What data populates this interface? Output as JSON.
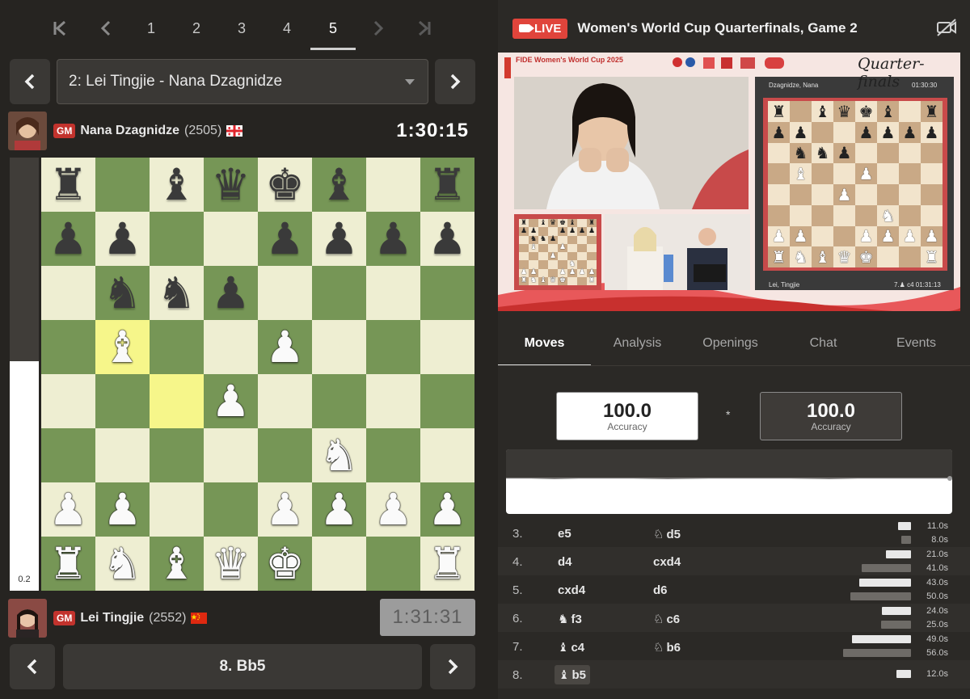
{
  "round_nav": {
    "first_icon": "first-page-icon",
    "prev_icon": "chevron-left-icon",
    "rounds": [
      "1",
      "2",
      "3",
      "4",
      "5"
    ],
    "active_round": "5",
    "next_icon": "chevron-right-icon",
    "last_icon": "last-page-icon"
  },
  "game_select": {
    "value": "2: Lei Tingjie - Nana Dzagnidze"
  },
  "top_player": {
    "title": "GM",
    "name": "Nana Dzagnidze",
    "rating": "(2505)",
    "country": "Georgia",
    "clock": "1:30:15"
  },
  "bottom_player": {
    "title": "GM",
    "name": "Lei Tingjie",
    "rating": "(2552)",
    "country": "China",
    "clock": "1:31:31"
  },
  "eval": {
    "label": "0.2",
    "white_fraction": 0.53
  },
  "board": {
    "light_color": "#eeeed2",
    "dark_color": "#769656",
    "highlight": [
      "b5",
      "c4"
    ],
    "ranks": [
      [
        "r",
        "",
        "b",
        "q",
        "k",
        "b",
        "",
        "r"
      ],
      [
        "p",
        "p",
        "",
        "",
        "p",
        "p",
        "p",
        "p"
      ],
      [
        "",
        "n",
        "n",
        "p",
        "",
        "",
        "",
        ""
      ],
      [
        "",
        "B",
        "",
        "",
        "P",
        "",
        "",
        ""
      ],
      [
        "",
        "",
        "",
        "P",
        "",
        "",
        "",
        ""
      ],
      [
        "",
        "",
        "",
        "",
        "",
        "N",
        "",
        ""
      ],
      [
        "P",
        "P",
        "",
        "",
        "P",
        "P",
        "P",
        "P"
      ],
      [
        "R",
        "N",
        "B",
        "Q",
        "K",
        "",
        "",
        "R"
      ]
    ]
  },
  "current_move": "8. Bb5",
  "stream": {
    "badge": "LIVE",
    "title": "Women's World Cup Quarterfinals, Game 2",
    "overlay_title": "Quarter-finals",
    "logo_text": "FIDE Women's World Cup 2025",
    "top_player": "Dzagnidze, Nana",
    "top_clock": "01:30:30",
    "bottom_player": "Lei, Tingjie",
    "bottom_info": "7.♟ c4   01:31:13"
  },
  "tabs": [
    "Moves",
    "Analysis",
    "Openings",
    "Chat",
    "Events"
  ],
  "active_tab": "Moves",
  "accuracy": {
    "white": "100.0",
    "black": "100.0",
    "label": "Accuracy",
    "separator": "*"
  },
  "moves": [
    {
      "num": "3.",
      "white": "e5",
      "white_piece": "",
      "black": "d5",
      "black_piece": "♘",
      "t_white": "11.0s",
      "t_black": "8.0s",
      "tw": 11,
      "tb": 8
    },
    {
      "num": "4.",
      "white": "d4",
      "white_piece": "",
      "black": "cxd4",
      "black_piece": "",
      "t_white": "21.0s",
      "t_black": "41.0s",
      "tw": 21,
      "tb": 41
    },
    {
      "num": "5.",
      "white": "cxd4",
      "white_piece": "",
      "black": "d6",
      "black_piece": "",
      "t_white": "43.0s",
      "t_black": "50.0s",
      "tw": 43,
      "tb": 50
    },
    {
      "num": "6.",
      "white": "f3",
      "white_piece": "♞",
      "black": "c6",
      "black_piece": "♘",
      "t_white": "24.0s",
      "t_black": "25.0s",
      "tw": 24,
      "tb": 25
    },
    {
      "num": "7.",
      "white": "c4",
      "white_piece": "♝",
      "black": "b6",
      "black_piece": "♘",
      "t_white": "49.0s",
      "t_black": "56.0s",
      "tw": 49,
      "tb": 56
    },
    {
      "num": "8.",
      "white": "b5",
      "white_piece": "♝",
      "black": "",
      "black_piece": "",
      "t_white": "12.0s",
      "t_black": "",
      "tw": 12,
      "tb": 0
    }
  ]
}
